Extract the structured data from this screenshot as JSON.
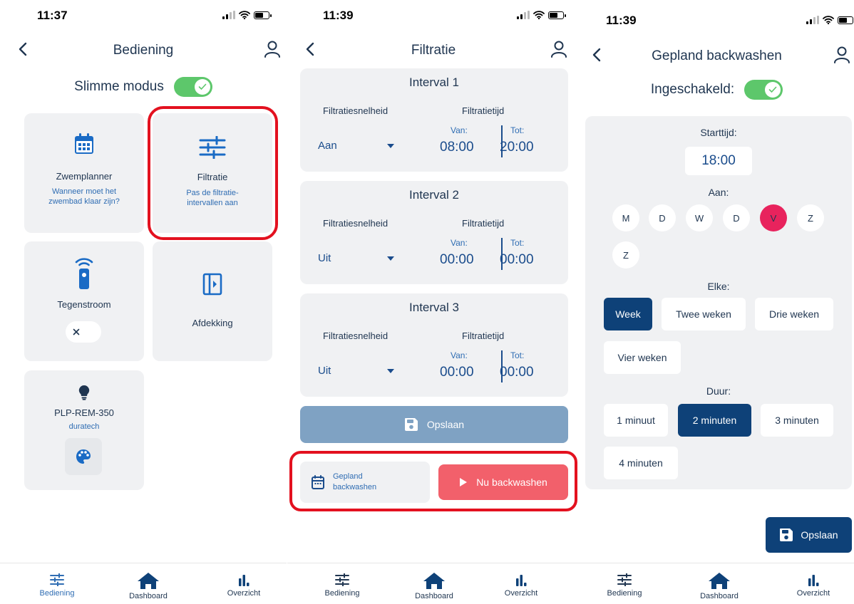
{
  "screen1": {
    "time": "11:37",
    "title": "Bediening",
    "smart_mode_label": "Slimme modus",
    "tiles": {
      "zwemplanner": {
        "title": "Zwemplanner",
        "subtitle_line1": "Wanneer moet het",
        "subtitle_line2": "zwembad klaar zijn?"
      },
      "filtratie": {
        "title": "Filtratie",
        "subtitle_line1": "Pas de filtratie-",
        "subtitle_line2": "intervallen aan"
      },
      "tegenstroom": {
        "title": "Tegenstroom"
      },
      "afdekking": {
        "title": "Afdekking"
      },
      "light": {
        "title": "PLP-REM-350",
        "subtitle": "duratech"
      }
    }
  },
  "screen2": {
    "time": "11:39",
    "title": "Filtratie",
    "speed_label": "Filtratiesnelheid",
    "time_label": "Filtratietijd",
    "from_label": "Van:",
    "to_label": "Tot:",
    "intervals": [
      {
        "title": "Interval 1",
        "speed": "Aan",
        "from": "08:00",
        "to": "20:00"
      },
      {
        "title": "Interval 2",
        "speed": "Uit",
        "from": "00:00",
        "to": "00:00"
      },
      {
        "title": "Interval 3",
        "speed": "Uit",
        "from": "00:00",
        "to": "00:00"
      }
    ],
    "save_label": "Opslaan",
    "planned_line1": "Gepland",
    "planned_line2": "backwashen",
    "now_label": "Nu backwashen"
  },
  "screen3": {
    "time": "11:39",
    "title": "Gepland backwashen",
    "enabled_label": "Ingeschakeld:",
    "start_label": "Starttijd:",
    "start_time": "18:00",
    "on_label": "Aan:",
    "days": [
      "M",
      "D",
      "W",
      "D",
      "V",
      "Z",
      "Z"
    ],
    "selected_day_index": 4,
    "every_label": "Elke:",
    "every_options": [
      "Week",
      "Twee weken",
      "Drie weken",
      "Vier weken"
    ],
    "every_selected": "Week",
    "duration_label": "Duur:",
    "duration_options": [
      "1 minuut",
      "2 minuten",
      "3 minuten",
      "4 minuten"
    ],
    "duration_selected": "2 minuten",
    "save_label": "Opslaan"
  },
  "nav": {
    "bediening": "Bediening",
    "dashboard": "Dashboard",
    "overzicht": "Overzicht"
  },
  "colors": {
    "primary": "#0e4178",
    "accent_blue": "#2f6db3",
    "toggle_green": "#5dc76b",
    "highlight_red": "#e3111f",
    "day_pink": "#e8235d",
    "backwash_red": "#f2606b",
    "tile_bg": "#f0f1f3"
  }
}
